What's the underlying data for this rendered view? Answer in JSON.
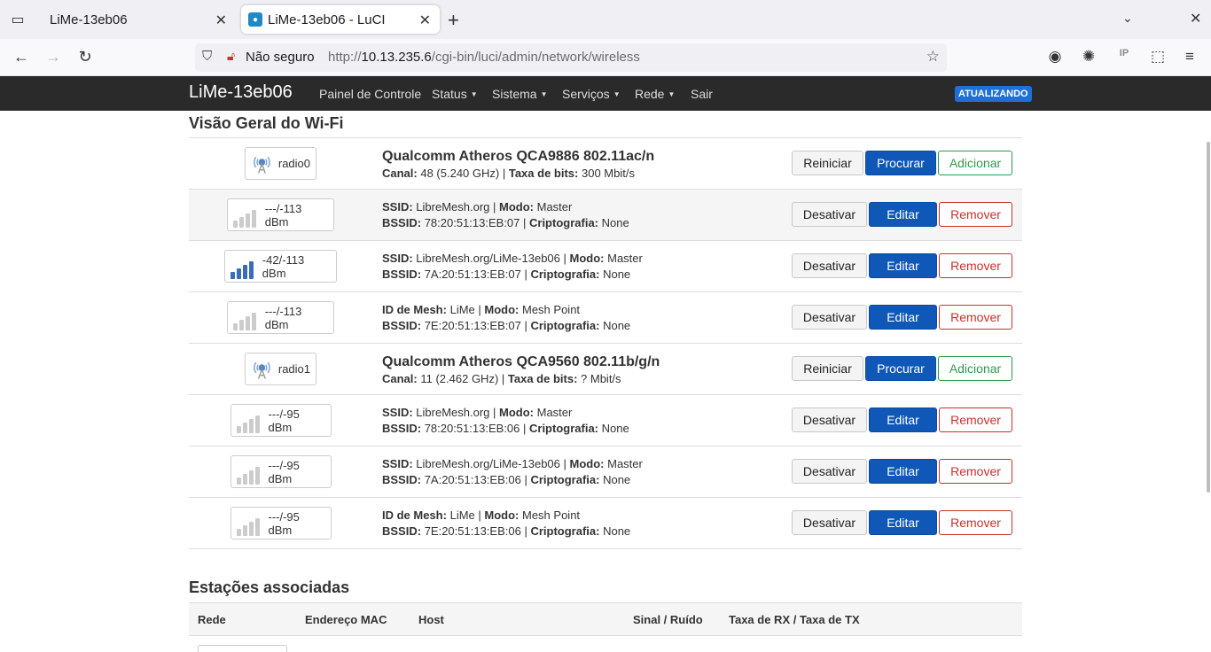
{
  "browser": {
    "tabs": [
      {
        "title": "LiMe-13eb06",
        "active": false
      },
      {
        "title": "LiMe-13eb06 - LuCI",
        "active": true
      }
    ],
    "url": {
      "security_label": "Não seguro",
      "prefix": "http://",
      "host": "10.13.235.6",
      "path": "/cgi-bin/luci/admin/network/wireless"
    }
  },
  "header": {
    "brand": "LiMe-13eb06",
    "menu": [
      "Painel de Controle",
      "Status",
      "Sistema",
      "Serviços",
      "Rede",
      "Sair"
    ],
    "badge": "ATUALIZANDO"
  },
  "wifi": {
    "title": "Visão Geral do Wi-Fi",
    "labels": {
      "canal": "Canal:",
      "taxa": "Taxa de bits:",
      "ssid": "SSID:",
      "modo": "Modo:",
      "bssid": "BSSID:",
      "cripto": "Criptografia:",
      "mesh": "ID de Mesh:"
    },
    "buttons": {
      "restart": "Reiniciar",
      "scan": "Procurar",
      "add": "Adicionar",
      "disable": "Desativar",
      "edit": "Editar",
      "remove": "Remover"
    },
    "rows": [
      {
        "kind": "radio",
        "badge": "radio0",
        "device": "Qualcomm Atheros QCA9886 802.11ac/n",
        "canal": "48 (5.240 GHz)",
        "taxa": "300 Mbit/s"
      },
      {
        "kind": "net",
        "signal": "---/-113 dBm",
        "bars": 0,
        "idlabel": "ssid",
        "id": "LibreMesh.org",
        "modo": "Master",
        "bssid": "78:20:51:13:EB:07",
        "cripto": "None"
      },
      {
        "kind": "net",
        "signal": "-42/-113 dBm",
        "bars": 4,
        "idlabel": "ssid",
        "id": "LibreMesh.org/LiMe-13eb06",
        "modo": "Master",
        "bssid": "7A:20:51:13:EB:07",
        "cripto": "None"
      },
      {
        "kind": "net",
        "signal": "---/-113 dBm",
        "bars": 0,
        "idlabel": "mesh",
        "id": "LiMe",
        "modo": "Mesh Point",
        "bssid": "7E:20:51:13:EB:07",
        "cripto": "None"
      },
      {
        "kind": "radio",
        "badge": "radio1",
        "device": "Qualcomm Atheros QCA9560 802.11b/g/n",
        "canal": "11 (2.462 GHz)",
        "taxa": "? Mbit/s"
      },
      {
        "kind": "net",
        "signal": "---/-95 dBm",
        "bars": 0,
        "idlabel": "ssid",
        "id": "LibreMesh.org",
        "modo": "Master",
        "bssid": "78:20:51:13:EB:06",
        "cripto": "None"
      },
      {
        "kind": "net",
        "signal": "---/-95 dBm",
        "bars": 0,
        "idlabel": "ssid",
        "id": "LibreMesh.org/LiMe-13eb06",
        "modo": "Master",
        "bssid": "7A:20:51:13:EB:06",
        "cripto": "None"
      },
      {
        "kind": "net",
        "signal": "---/-95 dBm",
        "bars": 0,
        "idlabel": "mesh",
        "id": "LiMe",
        "modo": "Mesh Point",
        "bssid": "7E:20:51:13:EB:06",
        "cripto": "None"
      }
    ]
  },
  "stations": {
    "title": "Estações associadas",
    "columns": [
      "Rede",
      "Endereço MAC",
      "Host",
      "Sinal / Ruído",
      "Taxa de RX / Taxa de TX"
    ]
  }
}
